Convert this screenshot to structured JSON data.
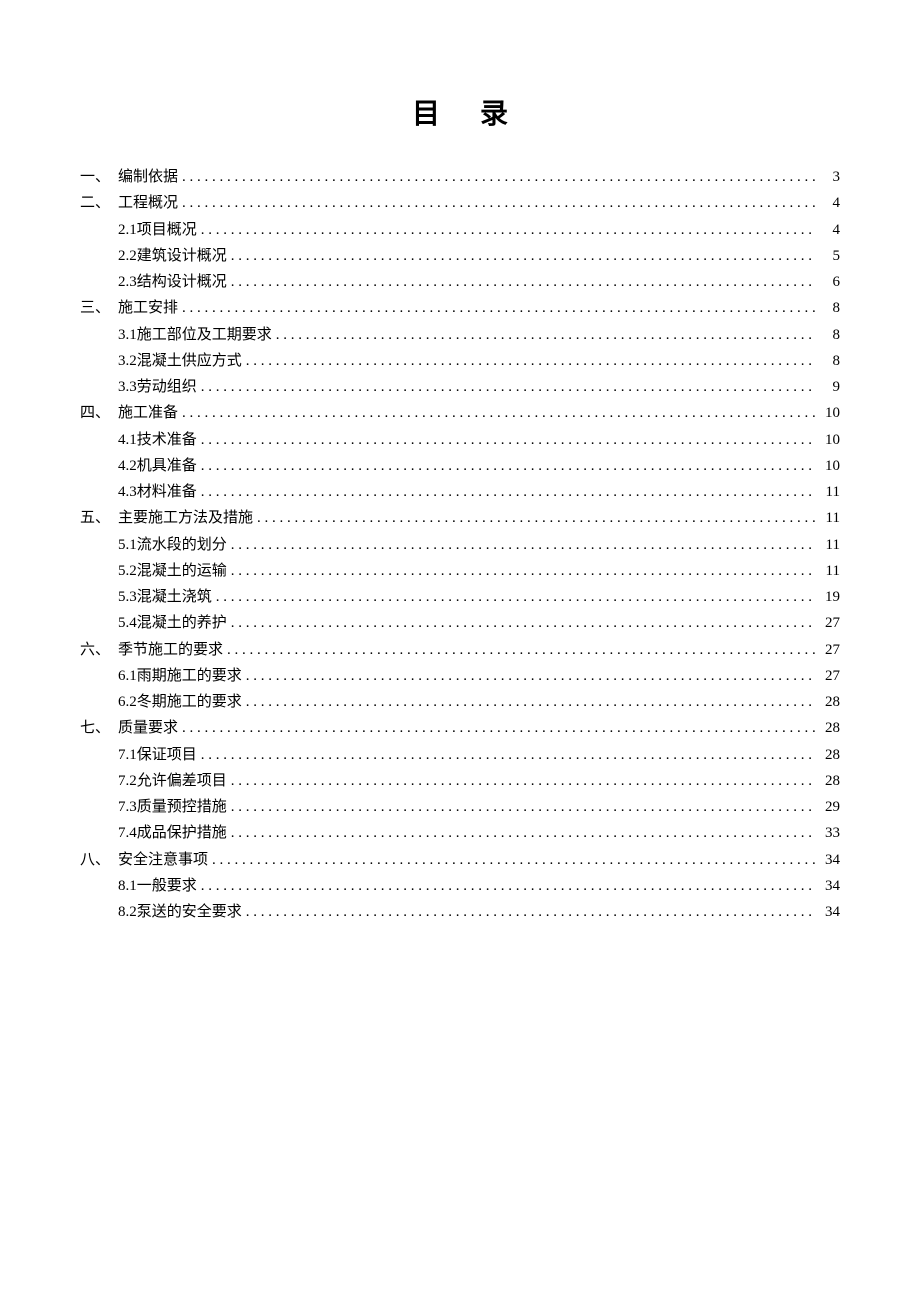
{
  "title": "目录",
  "toc": [
    {
      "level": 1,
      "prefix": "一、",
      "label": "编制依据",
      "page": "3"
    },
    {
      "level": 1,
      "prefix": "二、",
      "label": "工程概况",
      "page": "4"
    },
    {
      "level": 2,
      "prefix": "2.1 ",
      "label": "项目概况",
      "page": "4"
    },
    {
      "level": 2,
      "prefix": "2.2 ",
      "label": "建筑设计概况",
      "page": "5"
    },
    {
      "level": 2,
      "prefix": "2.3 ",
      "label": "结构设计概况",
      "page": "6"
    },
    {
      "level": 1,
      "prefix": "三、",
      "label": "施工安排",
      "page": "8"
    },
    {
      "level": 2,
      "prefix": "3.1 ",
      "label": "施工部位及工期要求",
      "page": "8"
    },
    {
      "level": 2,
      "prefix": "3.2 ",
      "label": "混凝土供应方式",
      "page": "8"
    },
    {
      "level": 2,
      "prefix": "3.3 ",
      "label": "劳动组织",
      "page": "9"
    },
    {
      "level": 1,
      "prefix": "四、",
      "label": "施工准备",
      "page": "10"
    },
    {
      "level": 2,
      "prefix": "4.1 ",
      "label": " 技术准备",
      "page": "10"
    },
    {
      "level": 2,
      "prefix": "4.2 ",
      "label": "机具准备",
      "page": "10"
    },
    {
      "level": 2,
      "prefix": "4.3 ",
      "label": "材料准备",
      "page": "11"
    },
    {
      "level": 1,
      "prefix": "五、",
      "label": "主要施工方法及措施",
      "page": "11"
    },
    {
      "level": 2,
      "prefix": "5.1 ",
      "label": "流水段的划分",
      "page": "11"
    },
    {
      "level": 2,
      "prefix": "5.2 ",
      "label": "混凝土的运输",
      "page": "11"
    },
    {
      "level": 2,
      "prefix": "5.3 ",
      "label": "混凝土浇筑",
      "page": "19"
    },
    {
      "level": 2,
      "prefix": "5.4 ",
      "label": "混凝土的养护",
      "page": "27"
    },
    {
      "level": 1,
      "prefix": "六、",
      "label": "季节施工的要求",
      "page": "27"
    },
    {
      "level": 2,
      "prefix": "6.1 ",
      "label": "雨期施工的要求",
      "page": "27"
    },
    {
      "level": 2,
      "prefix": "6.2 ",
      "label": "冬期施工的要求",
      "page": "28"
    },
    {
      "level": 1,
      "prefix": "七、",
      "label": "质量要求",
      "page": "28"
    },
    {
      "level": 2,
      "prefix": "7.1 ",
      "label": "保证项目",
      "page": "28"
    },
    {
      "level": 2,
      "prefix": "7.2 ",
      "label": " 允许偏差项目",
      "page": "28"
    },
    {
      "level": 2,
      "prefix": "7.3 ",
      "label": "质量预控措施",
      "page": "29"
    },
    {
      "level": 2,
      "prefix": "7.4 ",
      "label": "成品保护措施",
      "page": "33"
    },
    {
      "level": 1,
      "prefix": "八、",
      "label": "安全注意事项",
      "page": "34"
    },
    {
      "level": 2,
      "prefix": "8.1 ",
      "label": "一般要求",
      "page": "34"
    },
    {
      "level": 2,
      "prefix": "8.2 ",
      "label": "泵送的安全要求",
      "page": "34"
    }
  ]
}
